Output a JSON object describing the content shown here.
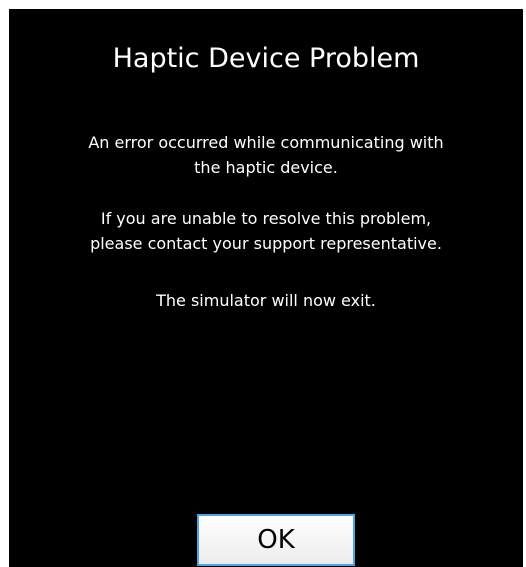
{
  "dialog": {
    "title": "Haptic Device Problem",
    "message_line1": "An error occurred while communicating with",
    "message_line2": "the haptic device.",
    "message_line3": "If you are unable to resolve this problem,",
    "message_line4": "please contact your support representative.",
    "message_line5": "The simulator will now exit.",
    "ok_label": "OK"
  },
  "colors": {
    "background": "#000000",
    "text": "#ffffff",
    "button_border": "#4aa4e8"
  }
}
